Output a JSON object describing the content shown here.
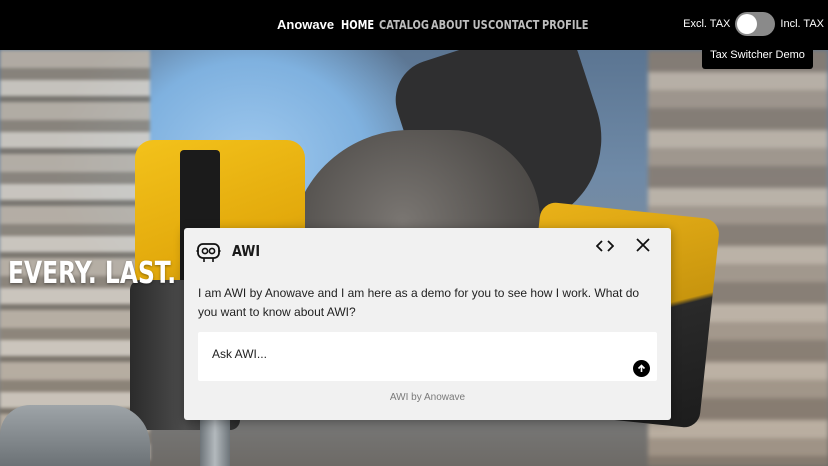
{
  "header": {
    "brand": "Anowave",
    "nav": [
      {
        "label": "Home",
        "active": true
      },
      {
        "label": "Catalog",
        "active": false
      },
      {
        "label": "About Us",
        "active": false
      },
      {
        "label": "Contact",
        "active": false
      },
      {
        "label": "Profile",
        "active": false
      }
    ],
    "tax": {
      "excl_label": "Excl. TAX",
      "incl_label": "Incl. TAX",
      "state": "excl"
    },
    "demo_badge": "Tax Switcher Demo"
  },
  "hero": {
    "title": "EVERY. LAST. B"
  },
  "chat": {
    "name": "AWI",
    "message": "I am AWI by Anowave and I am here as a demo for you to see how I work. What do you want to know about AWI?",
    "input_placeholder": "Ask AWI...",
    "footer": "AWI by Anowave",
    "icons": {
      "avatar": "robot-icon",
      "code": "code-icon",
      "close": "close-icon",
      "send": "arrow-up-icon"
    }
  },
  "colors": {
    "header_bg": "#000000",
    "chat_bg": "#f1f1f1",
    "accent": "#f3c21b"
  }
}
